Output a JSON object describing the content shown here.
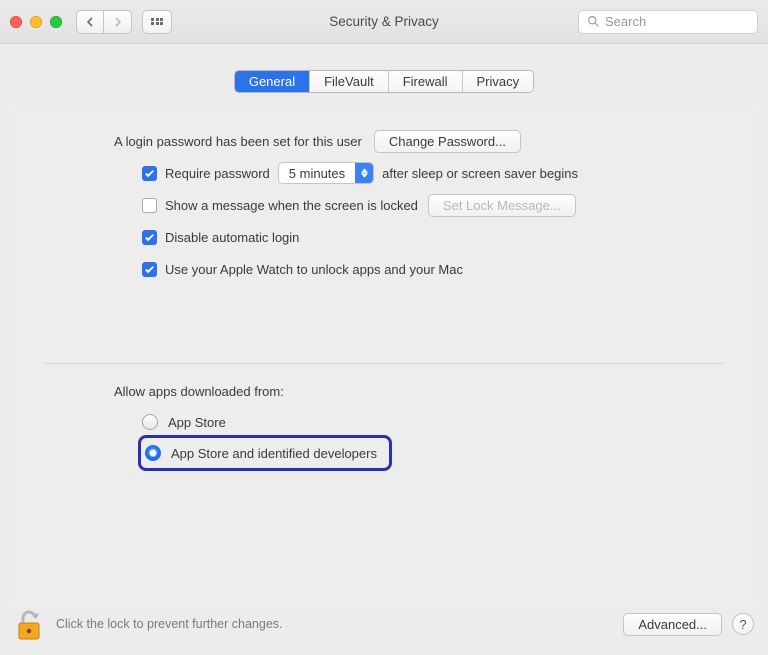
{
  "window": {
    "title": "Security & Privacy",
    "search_placeholder": "Search"
  },
  "tabs": [
    {
      "label": "General",
      "active": true
    },
    {
      "label": "FileVault",
      "active": false
    },
    {
      "label": "Firewall",
      "active": false
    },
    {
      "label": "Privacy",
      "active": false
    }
  ],
  "login": {
    "password_set_label": "A login password has been set for this user",
    "change_password_btn": "Change Password...",
    "require_password": {
      "checked": true,
      "prefix": "Require password",
      "delay": "5 minutes",
      "suffix": "after sleep or screen saver begins"
    },
    "show_message": {
      "checked": false,
      "label": "Show a message when the screen is locked",
      "set_btn": "Set Lock Message...",
      "set_btn_enabled": false
    },
    "disable_autologin": {
      "checked": true,
      "label": "Disable automatic login"
    },
    "apple_watch": {
      "checked": true,
      "label": "Use your Apple Watch to unlock apps and your Mac"
    }
  },
  "gatekeeper": {
    "title": "Allow apps downloaded from:",
    "options": [
      {
        "label": "App Store",
        "selected": false
      },
      {
        "label": "App Store and identified developers",
        "selected": true
      }
    ]
  },
  "footer": {
    "lock_text": "Click the lock to prevent further changes.",
    "advanced_btn": "Advanced...",
    "help": "?"
  }
}
